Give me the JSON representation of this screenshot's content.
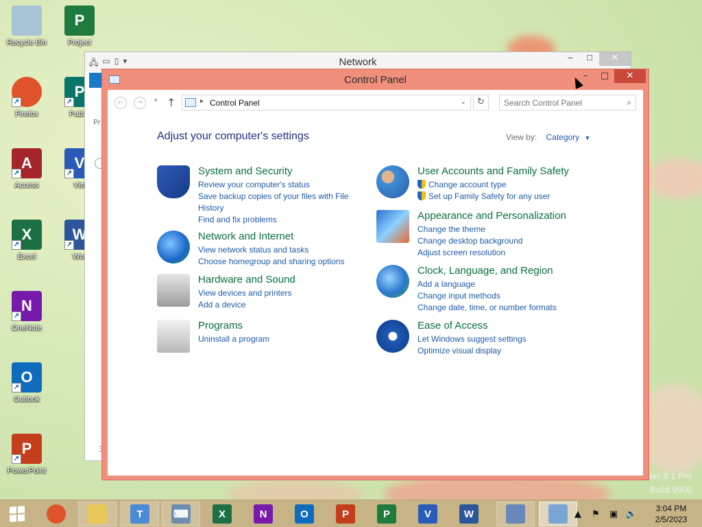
{
  "desktop": {
    "icons": [
      {
        "label": "Recycle Bin",
        "icon": "recycle-bin-icon",
        "color": "#a9c3d6",
        "glyph": ""
      },
      {
        "label": "Project",
        "icon": "project-icon",
        "color": "#1f7a3d",
        "glyph": "P"
      },
      {
        "label": "Firefox",
        "icon": "firefox-icon",
        "color": "#e0522a",
        "glyph": ""
      },
      {
        "label": "Publis",
        "icon": "publisher-icon",
        "color": "#077568",
        "glyph": "P"
      },
      {
        "label": "Access",
        "icon": "access-icon",
        "color": "#a4262c",
        "glyph": "A"
      },
      {
        "label": "Visi",
        "icon": "visio-icon",
        "color": "#2b5bb8",
        "glyph": "V"
      },
      {
        "label": "Excel",
        "icon": "excel-icon",
        "color": "#1d7044",
        "glyph": "X"
      },
      {
        "label": "Wor",
        "icon": "word-icon",
        "color": "#2b579a",
        "glyph": "W"
      },
      {
        "label": "OneNote",
        "icon": "onenote-icon",
        "color": "#7719aa",
        "glyph": "N"
      },
      {
        "label": "Outlook",
        "icon": "outlook-icon",
        "color": "#0f6cbd",
        "glyph": "O"
      },
      {
        "label": "PowerPoint",
        "icon": "powerpoint-icon",
        "color": "#c43e1c",
        "glyph": "P"
      }
    ],
    "watermark_line1": "ws 8.1 Pro",
    "watermark_line2": "Build 9600"
  },
  "network_window": {
    "title": "Network",
    "minimize": "–",
    "maximize": "□",
    "close": "✕",
    "side_text": "Pr",
    "bottom_text": "3"
  },
  "control_panel": {
    "title": "Control Panel",
    "minimize": "–",
    "maximize": "□",
    "close": "✕",
    "address_text": "Control Panel",
    "search_placeholder": "Search Control Panel",
    "heading": "Adjust your computer's settings",
    "view_by_label": "View by:",
    "view_by_value": "Category",
    "categories": [
      {
        "title": "System and Security",
        "icon": "system-security-shield-icon",
        "links": [
          "Review your computer's status",
          "Save backup copies of your files with File",
          "History",
          "Find and fix problems"
        ]
      },
      {
        "title": "Network and Internet",
        "icon": "network-internet-globe-icon",
        "links": [
          "View network status and tasks",
          "Choose homegroup and sharing options"
        ]
      },
      {
        "title": "Hardware and Sound",
        "icon": "hardware-sound-printer-icon",
        "links": [
          "View devices and printers",
          "Add a device"
        ]
      },
      {
        "title": "Programs",
        "icon": "programs-box-icon",
        "links": [
          "Uninstall a program"
        ]
      },
      {
        "title": "User Accounts and Family Safety",
        "icon": "user-accounts-icon",
        "links": [
          "Change account type",
          "Set up Family Safety for any user"
        ]
      },
      {
        "title": "Appearance and Personalization",
        "icon": "appearance-monitor-icon",
        "links": [
          "Change the theme",
          "Change desktop background",
          "Adjust screen resolution"
        ]
      },
      {
        "title": "Clock, Language, and Region",
        "icon": "clock-globe-icon",
        "links": [
          "Add a language",
          "Change input methods",
          "Change date, time, or number formats"
        ]
      },
      {
        "title": "Ease of Access",
        "icon": "ease-of-access-icon",
        "links": [
          "Let Windows suggest settings",
          "Optimize visual display"
        ]
      }
    ]
  },
  "taskbar": {
    "apps": [
      {
        "name": "firefox",
        "icon": "firefox-icon",
        "color": "#e0522a",
        "glyph": ""
      },
      {
        "name": "file-explorer",
        "icon": "file-explorer-icon",
        "color": "#e9c85b",
        "glyph": ""
      },
      {
        "name": "teams",
        "icon": "teams-icon",
        "color": "#4b8bd6",
        "glyph": "T"
      },
      {
        "name": "on-screen-keyboard",
        "icon": "keyboard-icon",
        "color": "#6f8db0",
        "glyph": "⌨"
      },
      {
        "name": "excel",
        "icon": "excel-icon",
        "color": "#1d7044",
        "glyph": "X"
      },
      {
        "name": "onenote",
        "icon": "onenote-icon",
        "color": "#7719aa",
        "glyph": "N"
      },
      {
        "name": "outlook",
        "icon": "outlook-icon",
        "color": "#0f6cbd",
        "glyph": "O"
      },
      {
        "name": "powerpoint",
        "icon": "powerpoint-icon",
        "color": "#c43e1c",
        "glyph": "P"
      },
      {
        "name": "project",
        "icon": "project-icon",
        "color": "#1f7a3d",
        "glyph": "P"
      },
      {
        "name": "visio",
        "icon": "visio-icon",
        "color": "#2b5bb8",
        "glyph": "V"
      },
      {
        "name": "word",
        "icon": "word-icon",
        "color": "#2b579a",
        "glyph": "W"
      },
      {
        "name": "network",
        "icon": "network-icon",
        "color": "#6788b8",
        "glyph": ""
      },
      {
        "name": "control-panel",
        "icon": "control-panel-icon",
        "color": "#7aa6d6",
        "glyph": ""
      }
    ],
    "time": "3:04 PM",
    "date": "2/5/2023"
  }
}
